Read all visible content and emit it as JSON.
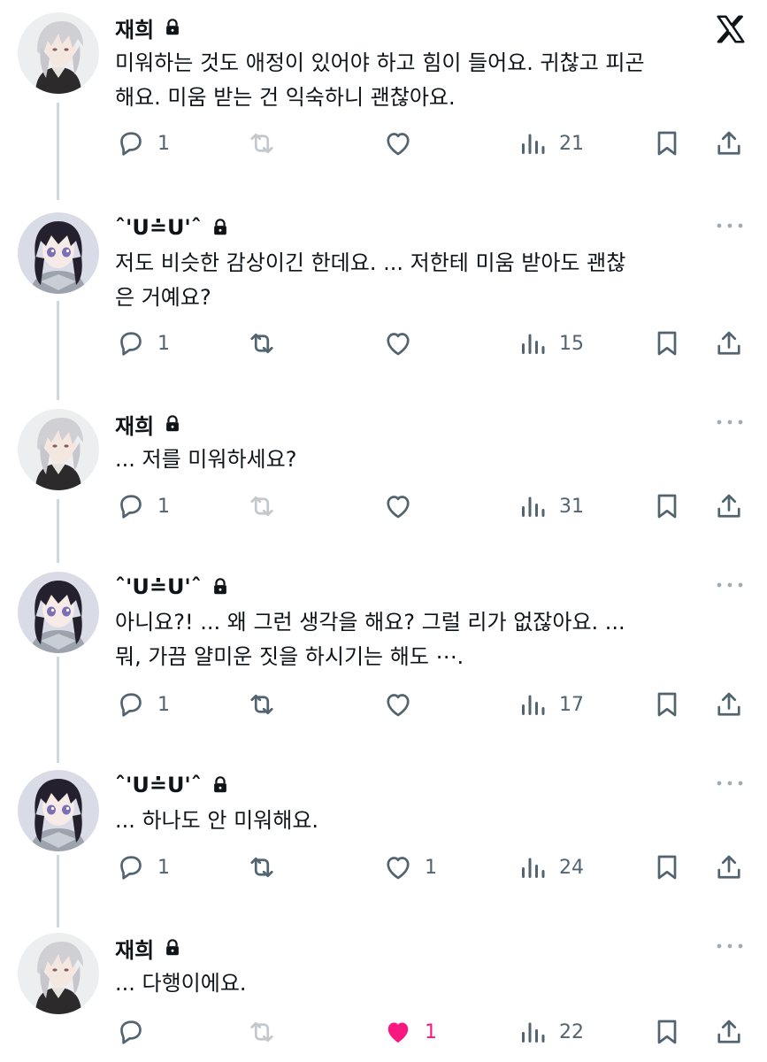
{
  "brand": {
    "icon": "x-logo"
  },
  "colors": {
    "like_active": "#f91880",
    "icon": "#536471",
    "thread_line": "#cfd9de"
  },
  "tweets": [
    {
      "author": "재희",
      "text": "미워하는 것도 애정이 있어야 하고 힘이 들어요. 귀찮고 피곤\n해요. 미움 받는 건 익숙하니 괜찮아요.",
      "replies": "1",
      "retweets": "",
      "likes": "",
      "views": "21"
    },
    {
      "author": "ˆ'ᑌ≐ᑌ'ˆ",
      "text": "저도 비슷한 감상이긴 한데요. ... 저한테 미움 받아도 괜찮\n은 거예요?",
      "replies": "1",
      "retweets": "",
      "likes": "",
      "views": "15"
    },
    {
      "author": "재희",
      "text": "... 저를 미워하세요?",
      "replies": "1",
      "retweets": "",
      "likes": "",
      "views": "31"
    },
    {
      "author": "ˆ'ᑌ≐ᑌ'ˆ",
      "text": "아니요?! ... 왜 그런 생각을 해요? 그럴 리가 없잖아요. ...\n뭐, 가끔 얄미운 짓을 하시기는 해도 ⋯.",
      "replies": "1",
      "retweets": "",
      "likes": "",
      "views": "17"
    },
    {
      "author": "ˆ'ᑌ≐ᑌ'ˆ",
      "text": "... 하나도 안 미워해요.",
      "replies": "1",
      "retweets": "",
      "likes": "1",
      "views": "24"
    },
    {
      "author": "재희",
      "text": "... 다행이에요.",
      "replies": "",
      "retweets": "",
      "likes": "1",
      "views": "22"
    }
  ]
}
